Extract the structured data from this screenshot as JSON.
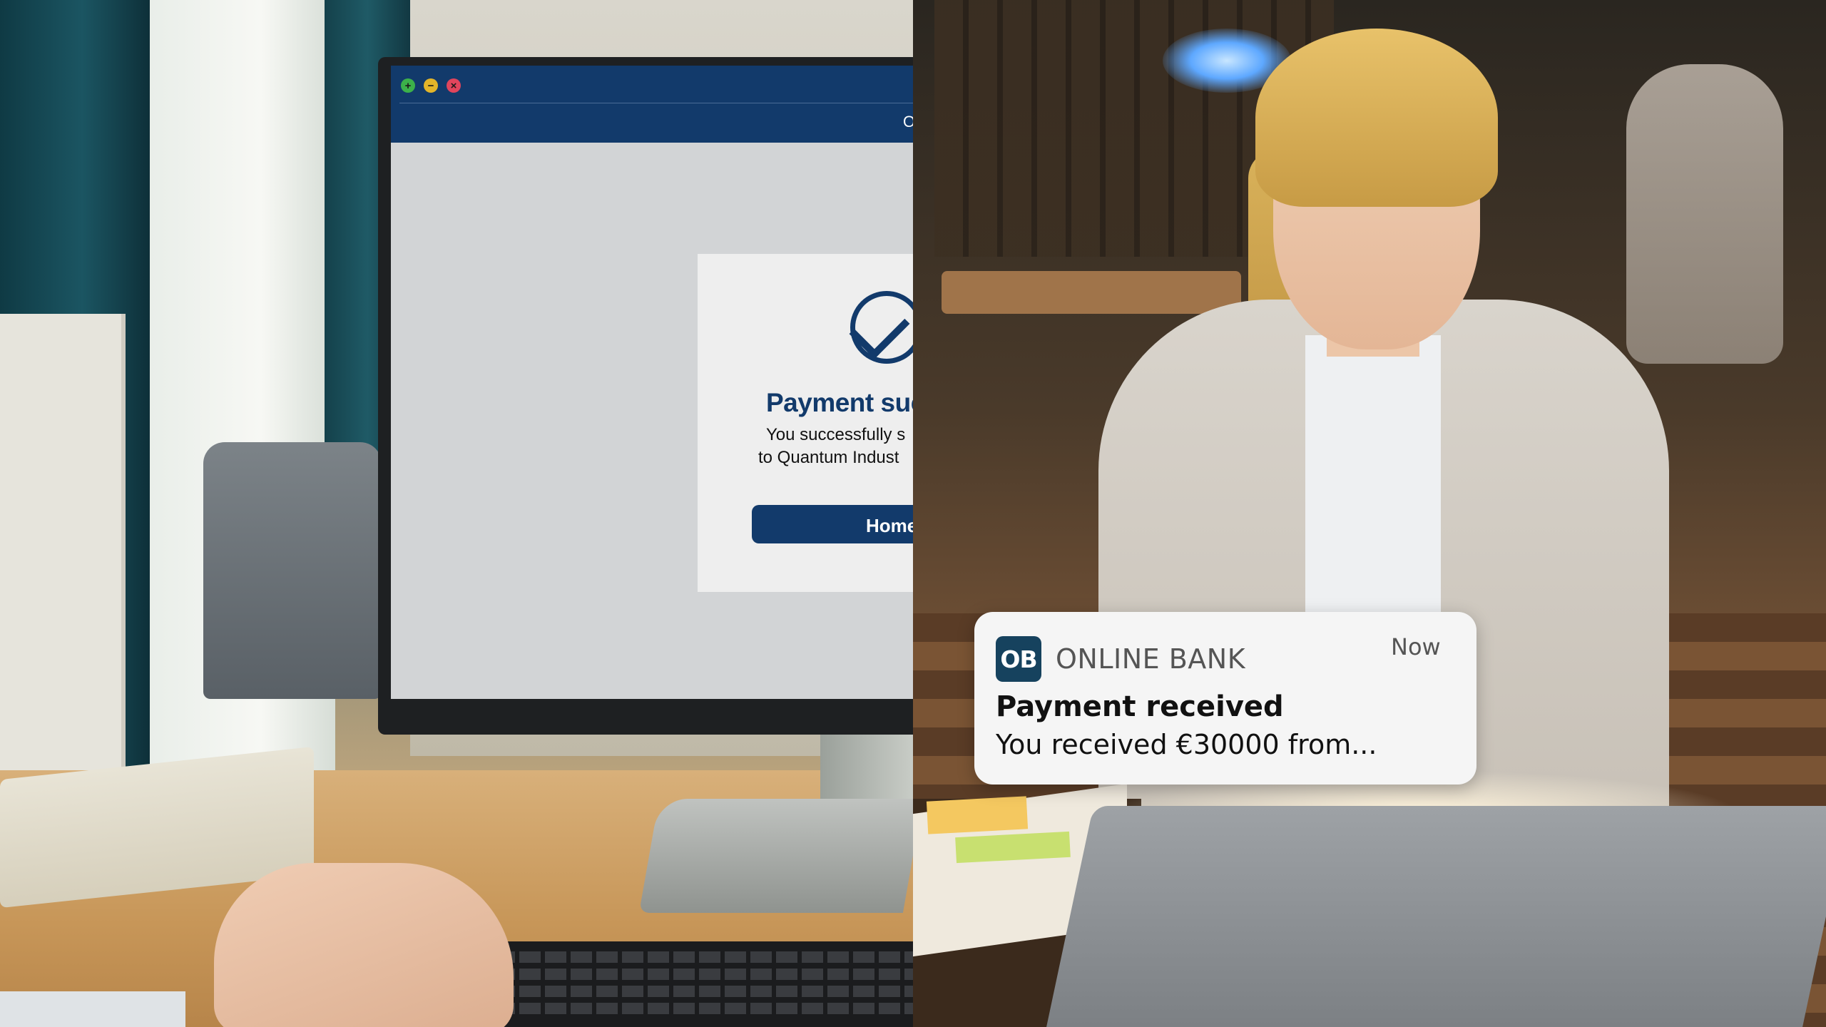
{
  "desktop_window": {
    "title_text": "O",
    "controls": {
      "maximize": "+",
      "minimize": "−",
      "close": "×"
    },
    "modal": {
      "title": "Payment suc",
      "message_line1": "You successfully s",
      "message_line2": "to Quantum Indust",
      "home_button_label": "Home"
    }
  },
  "notification": {
    "app_icon_text": "OB",
    "app_name": "ONLINE BANK",
    "time": "Now",
    "title": "Payment received",
    "body": "You received €30000 from..."
  },
  "colors": {
    "brand_navy": "#123a6b",
    "notification_icon": "#16425e",
    "notification_bg": "#f5f5f5"
  }
}
